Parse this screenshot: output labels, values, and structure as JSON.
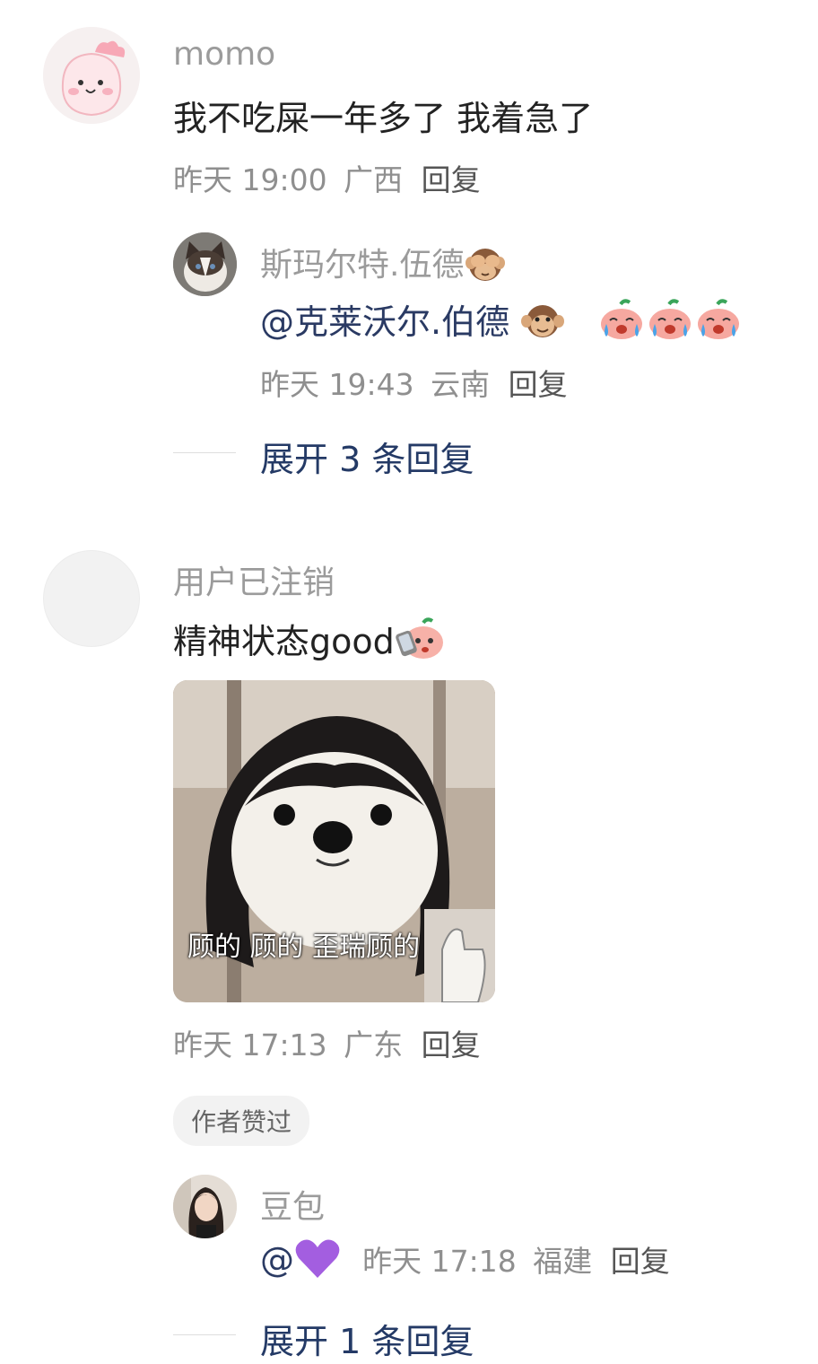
{
  "colors": {
    "link": "#243a66",
    "meta": "#8f8f8f",
    "name": "#9b9b9b"
  },
  "comments": [
    {
      "username": "momo",
      "text": "我不吃屎一年多了  我着急了",
      "time": "昨天 19:00",
      "location": "广西",
      "reply_label": "回复",
      "replies": [
        {
          "username": "斯玛尔特.伍德",
          "username_emoji": "see-no-evil-monkey",
          "mention": "@克莱沃尔.伯德",
          "emojis": [
            "monkey-face",
            "crying-peach",
            "crying-peach",
            "crying-peach"
          ],
          "time": "昨天 19:43",
          "location": "云南",
          "reply_label": "回复"
        }
      ],
      "expand_label": "展开 3 条回复"
    },
    {
      "username": "用户已注销",
      "text": "精神状态good",
      "text_emoji": "peach-with-phone",
      "image_caption": "顾的 顾的 歪瑞顾的",
      "time": "昨天 17:13",
      "location": "广东",
      "reply_label": "回复",
      "author_badge": "作者赞过",
      "replies": [
        {
          "username": "豆包",
          "mention": "@",
          "mention_emoji": "purple-heart",
          "time": "昨天 17:18",
          "location": "福建",
          "reply_label": "回复"
        }
      ],
      "expand_label": "展开 1 条回复"
    }
  ]
}
